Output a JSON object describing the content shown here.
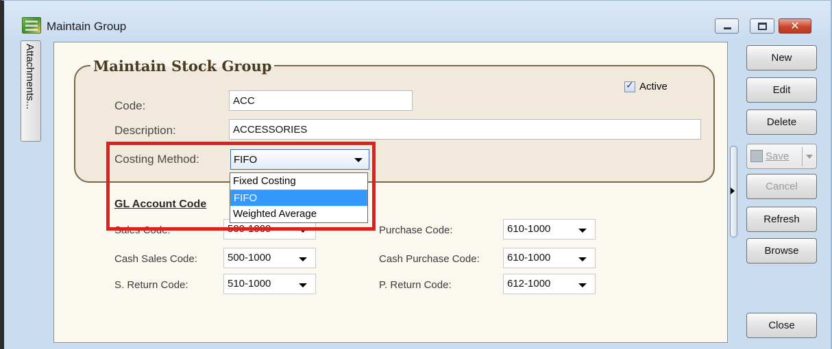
{
  "window": {
    "title": "Maintain Group",
    "controls": {
      "minimize": "minimize",
      "maximize": "maximize",
      "close": "✕"
    }
  },
  "side_tab": {
    "label": "Attachments..."
  },
  "form": {
    "group_title": "Maintain Stock Group",
    "active_label": "Active",
    "active_checked": true,
    "code_label": "Code:",
    "code_value": "ACC",
    "description_label": "Description:",
    "description_value": "ACCESSORIES",
    "costing_label": "Costing Method:",
    "costing_value": "FIFO",
    "costing_options": [
      "Fixed Costing",
      "FIFO",
      "Weighted Average"
    ],
    "costing_selected_index": 1
  },
  "gl": {
    "title": "GL Account Code",
    "sales_label": "Sales Code:",
    "sales_value": "500-1000",
    "cash_sales_label": "Cash Sales Code:",
    "cash_sales_value": "500-1000",
    "sreturn_label": "S. Return Code:",
    "sreturn_value": "510-1000",
    "purchase_label": "Purchase Code:",
    "purchase_value": "610-1000",
    "cash_purchase_label": "Cash Purchase Code:",
    "cash_purchase_value": "610-1000",
    "preturn_label": "P. Return Code:",
    "preturn_value": "612-1000"
  },
  "toolbar": {
    "new_label": "New",
    "edit_label": "Edit",
    "delete_label": "Delete",
    "save_label": "Save",
    "cancel_label": "Cancel",
    "refresh_label": "Refresh",
    "browse_label": "Browse",
    "close_label": "Close"
  },
  "colors": {
    "highlight": "#e0201c",
    "selection": "#3399ff",
    "group_border": "#786545"
  }
}
